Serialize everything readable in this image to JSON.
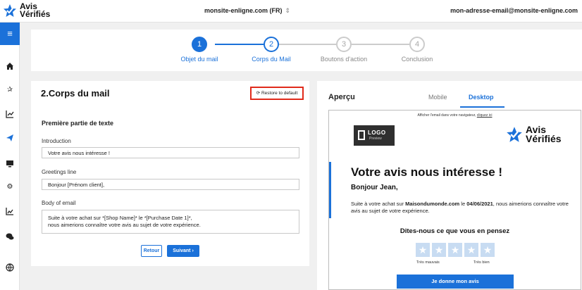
{
  "app": {
    "brand_line1": "Avis",
    "brand_line2": "Vérifiés"
  },
  "header": {
    "site": "monsite-enligne.com",
    "locale": "(FR)",
    "account_email": "mon-adresse-email@monsite-enligne.com"
  },
  "sidebar": {
    "items": [
      "menu-icon",
      "home-icon",
      "star-icon",
      "chart-icon",
      "send-icon",
      "monitor-icon",
      "gear-icon",
      "analytics-icon",
      "chat-icon",
      "globe-icon"
    ],
    "accent": "#1b71d9"
  },
  "stepper": {
    "steps": [
      {
        "num": "1",
        "label": "Objet du mail"
      },
      {
        "num": "2",
        "label": "Corps du Mail"
      },
      {
        "num": "3",
        "label": "Boutons d'action"
      },
      {
        "num": "4",
        "label": "Conclusion"
      }
    ],
    "current": 2
  },
  "editor": {
    "title": "2.Corps du mail",
    "restore_label": "Restore to default",
    "section_title": "Première partie de texte",
    "intro_label": "Introduction",
    "intro_value": "Votre avis nous intéresse !",
    "greetings_label": "Greetings line",
    "greetings_value": "Bonjour [Prénom client],",
    "body_label": "Body of email",
    "body_line1": "Suite à votre achat sur *[Shop Name]* le *[Purchase Date 1]*,",
    "body_line2": "nous aimerions connaître votre avis au sujet de votre expérience.",
    "back_label": "Retour",
    "next_label": "Suivant"
  },
  "preview": {
    "title": "Aperçu",
    "tab_mobile": "Mobile",
    "tab_desktop": "Desktop",
    "browser_note": "Afficher l'email dans votre navigateur,",
    "browser_link": "cliquez ici",
    "logo_text": "LOGO",
    "logo_sub": "Preview",
    "email_title": "Votre avis nous intéresse !",
    "greeting": "Bonjour Jean,",
    "text_pre": "Suite à votre achat sur ",
    "shop": "Maisondumonde.com",
    "text_mid": " le ",
    "date": "04/06/2021",
    "text_post": ", nous aimerions connaître votre avis au sujet de votre expérience.",
    "question": "Dites-nous ce que vous en pensez",
    "scale_low": "Très mauvais",
    "scale_high": "Très bien",
    "cta": "Je donne mon avis",
    "stars": 5
  }
}
